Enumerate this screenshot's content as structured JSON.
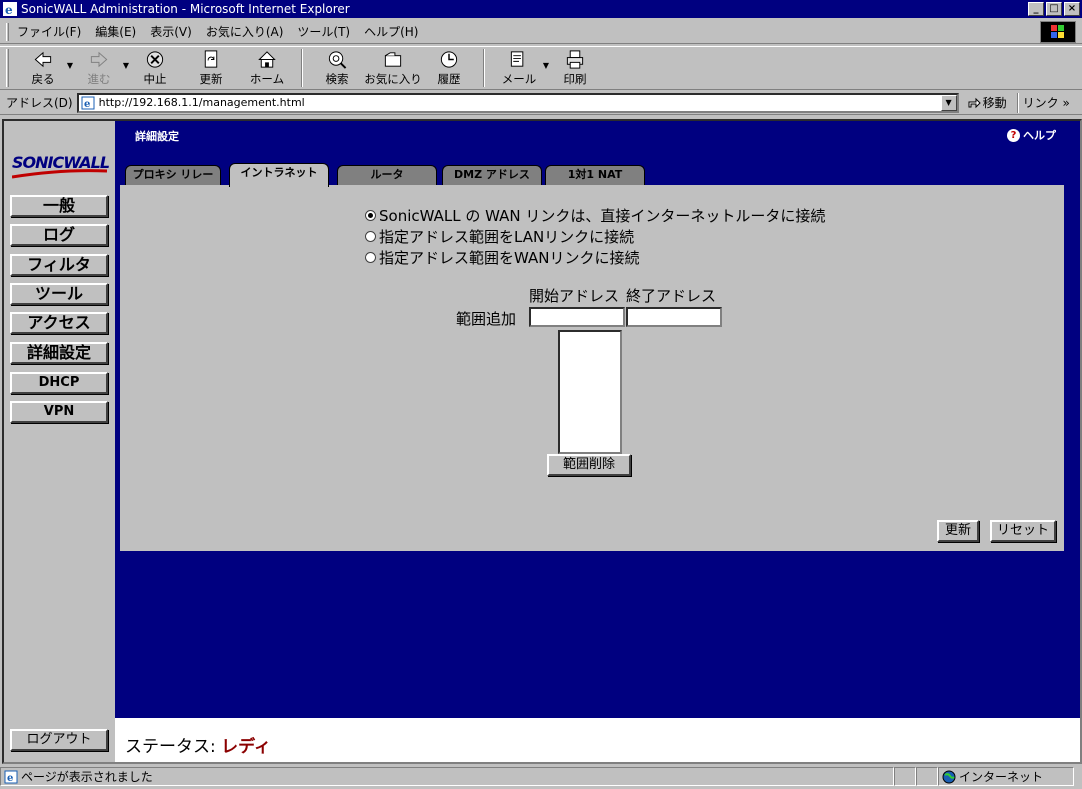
{
  "window": {
    "title": "SonicWALL Administration - Microsoft Internet Explorer",
    "controls": [
      "_",
      "□",
      "×"
    ]
  },
  "menu": [
    "ファイル(F)",
    "編集(E)",
    "表示(V)",
    "お気に入り(A)",
    "ツール(T)",
    "ヘルプ(H)"
  ],
  "toolbar": {
    "back": "戻る",
    "forward": "進む",
    "stop": "中止",
    "refresh": "更新",
    "home": "ホーム",
    "search": "検索",
    "favorites": "お気に入り",
    "history": "履歴",
    "mail": "メール",
    "print": "印刷"
  },
  "address": {
    "label": "アドレス(D)",
    "url": "http://192.168.1.1/management.html",
    "go": "移動",
    "links": "リンク »"
  },
  "sidebar": {
    "logo": "SONICWALL",
    "items": [
      "一般",
      "ログ",
      "フィルタ",
      "ツール",
      "アクセス",
      "詳細設定",
      "DHCP",
      "VPN"
    ],
    "logout": "ログアウト"
  },
  "page": {
    "heading": "詳細設定",
    "help": "ヘルプ",
    "help_icon": "?"
  },
  "tabs": [
    "プロキシ リレー",
    "イントラネット",
    "ルータ",
    "DMZ アドレス",
    "1対1 NAT"
  ],
  "active_tab": "イントラネット",
  "intranet": {
    "options": [
      "SonicWALL の WAN リンクは、直接インターネットルータに接続",
      "指定アドレス範囲をLANリンクに接続",
      "指定アドレス範囲をWANリンクに接続"
    ],
    "selected_option": 0,
    "start_header": "開始アドレス",
    "end_header": "終了アドレス",
    "add_range_label": "範囲追加",
    "start_value": "",
    "end_value": "",
    "delete_button": "範囲削除",
    "update_button": "更新",
    "reset_button": "リセット"
  },
  "status": {
    "label": "ステータス: ",
    "value": "レディ"
  },
  "ie_status": {
    "message": "ページが表示されました",
    "zone": "インターネット"
  }
}
